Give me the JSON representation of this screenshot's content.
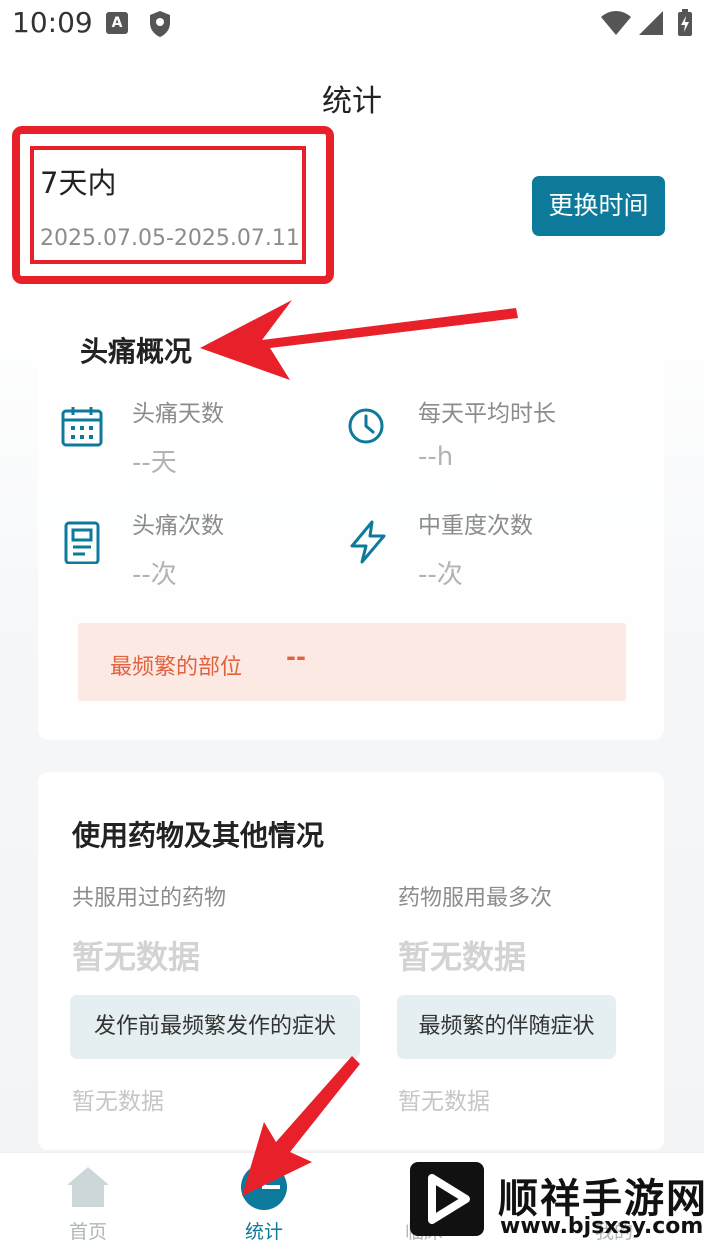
{
  "status_bar": {
    "time": "10:09"
  },
  "header": {
    "title": "统计"
  },
  "range": {
    "label": "7天内",
    "dates": "2025.07.05-2025.07.11",
    "change_button": "更换时间"
  },
  "overview": {
    "title": "头痛概况",
    "stats": [
      {
        "label": "头痛天数",
        "value": "--天",
        "icon": "calendar-icon"
      },
      {
        "label": "每天平均时长",
        "value": "--h",
        "icon": "clock-icon"
      },
      {
        "label": "头痛次数",
        "value": "--次",
        "icon": "document-icon"
      },
      {
        "label": "中重度次数",
        "value": "--次",
        "icon": "lightning-icon"
      }
    ],
    "frequent_location": {
      "label": "最频繁的部位",
      "value": "--"
    }
  },
  "medication": {
    "title": "使用药物及其他情况",
    "taken_label": "共服用过的药物",
    "taken_value": "暂无数据",
    "most_label": "药物服用最多次",
    "most_value": "暂无数据",
    "pre_symptom_button": "发作前最频繁发作的症状",
    "pre_symptom_value": "暂无数据",
    "accompany_button": "最频繁的伴随症状",
    "accompany_value": "暂无数据"
  },
  "nav": {
    "items": [
      {
        "label": "首页",
        "icon": "home-icon"
      },
      {
        "label": "统计",
        "icon": "pie-chart-icon",
        "active": true
      },
      {
        "label": "临床",
        "icon": "clinical-icon"
      },
      {
        "label": "我的",
        "icon": "profile-icon"
      }
    ]
  },
  "watermark": {
    "name": "顺祥手游网",
    "url": "www.bjsxsy.com"
  },
  "colors": {
    "accent": "#0e7a9b",
    "highlight_red": "#e8202a",
    "warn": "#e2623e",
    "warn_bg": "#fce9e4"
  }
}
